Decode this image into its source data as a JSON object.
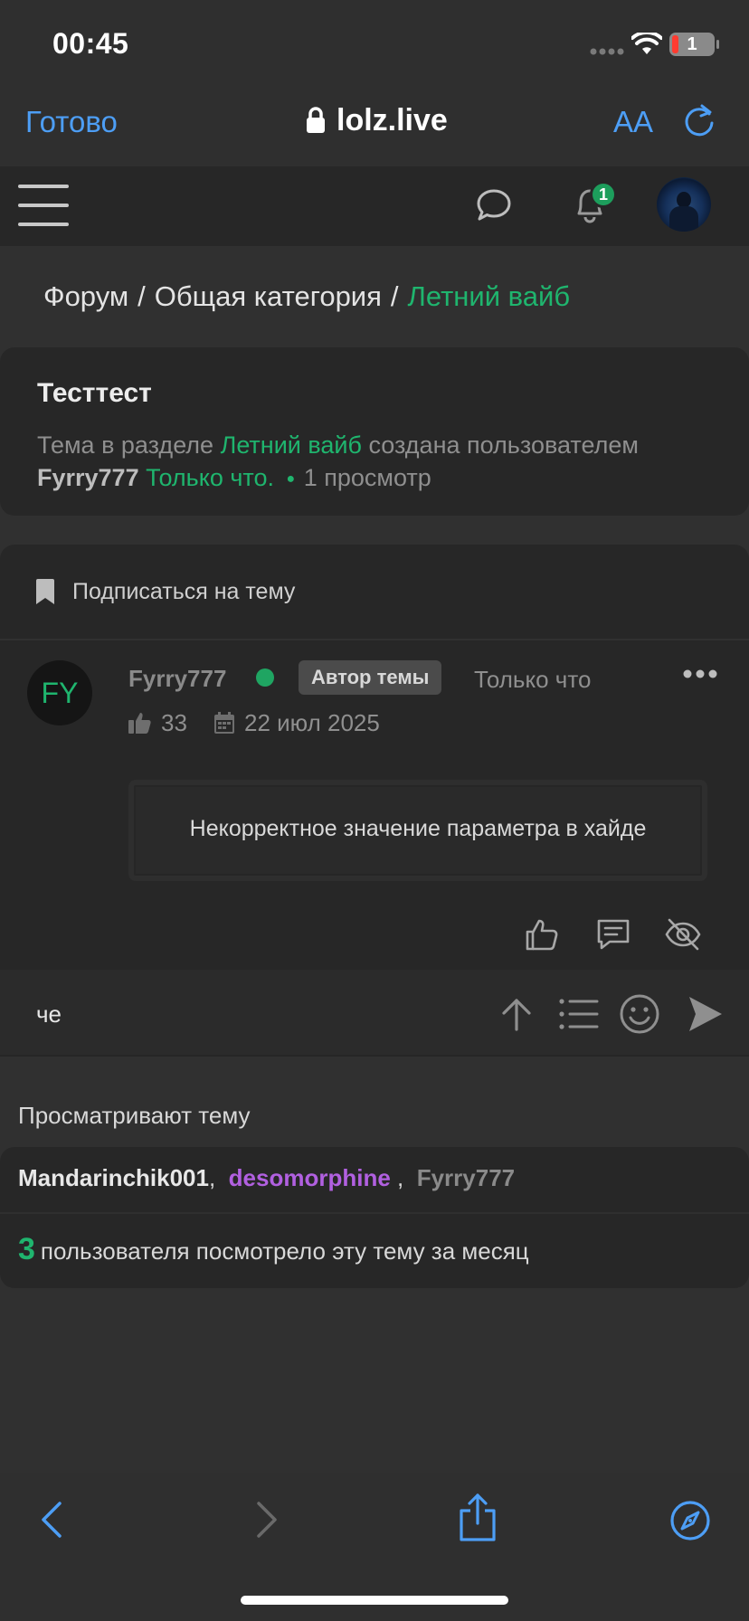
{
  "status_bar": {
    "time": "00:45",
    "battery": "1"
  },
  "browser": {
    "done_label": "Готово",
    "url": "lolz.live",
    "text_size_label": "AA"
  },
  "navbar": {
    "notifications_count": "1"
  },
  "breadcrumb": {
    "items": [
      "Форум",
      "Общая категория",
      "Летний вайб"
    ],
    "separator": "/"
  },
  "thread": {
    "title": "Тесттест",
    "info_prefix": "Тема в разделе",
    "section": "Летний вайб",
    "info_created": "создана пользователем",
    "author": "Fyrry777",
    "created_time": "Только что.",
    "views": "1 просмотр"
  },
  "subscribe": {
    "label": "Подписаться на тему"
  },
  "post": {
    "avatar_initials": "FY",
    "username": "Fyrry777",
    "author_badge": "Автор темы",
    "time": "Только что",
    "likes": "33",
    "date": "22 июл 2025",
    "hide_message": "Некорректное значение параметра в хайде"
  },
  "reply": {
    "text": "че"
  },
  "viewing": {
    "title": "Просматривают тему",
    "users": [
      {
        "name": "Mandarinchik001",
        "color": "#e8e8e8"
      },
      {
        "name": "desomorphine",
        "color": "#b160e0"
      },
      {
        "name": "Fyrry777",
        "color": "#8a8a8a"
      }
    ],
    "monthly_count": "3",
    "monthly_text": "пользователя посмотрело эту тему за месяц"
  },
  "colors": {
    "accent_green": "#1fb56e",
    "link_blue": "#4d9ef5",
    "background": "#303030"
  }
}
